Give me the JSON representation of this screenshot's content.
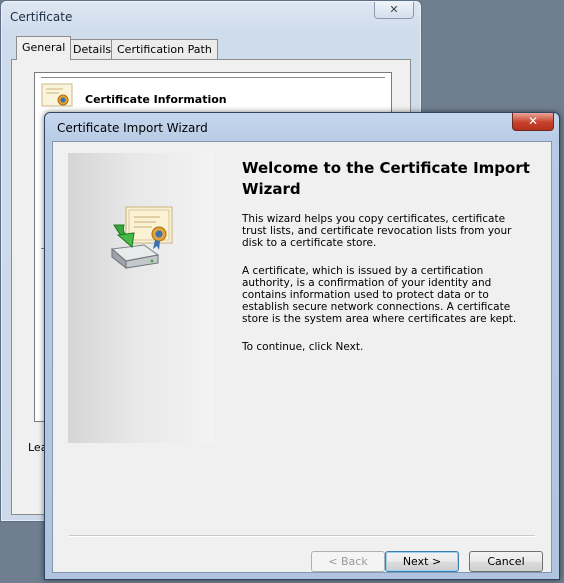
{
  "background_window": {
    "title": "Certificate",
    "close_glyph": "✕",
    "tabs": [
      {
        "label": "General",
        "active": true
      },
      {
        "label": "Details",
        "active": false
      },
      {
        "label": "Certification Path",
        "active": false
      }
    ],
    "cert_info_heading": "Certificate Information",
    "learn_text": "Lear"
  },
  "wizard": {
    "title": "Certificate Import Wizard",
    "close_glyph": "✕",
    "heading": "Welcome to the Certificate Import Wizard",
    "paragraphs": [
      "This wizard helps you copy certificates, certificate trust lists, and certificate revocation lists from your disk to a certificate store.",
      "A certificate, which is issued by a certification authority, is a confirmation of your identity and contains information used to protect data or to establish secure network connections. A certificate store is the system area where certificates are kept.",
      "To continue, click Next."
    ],
    "buttons": {
      "back": "< Back",
      "next": "Next >",
      "cancel": "Cancel"
    },
    "icon": "certificate-import-icon"
  },
  "colors": {
    "wizard_close": "#c8412c",
    "desktop": "#6f7f90"
  }
}
